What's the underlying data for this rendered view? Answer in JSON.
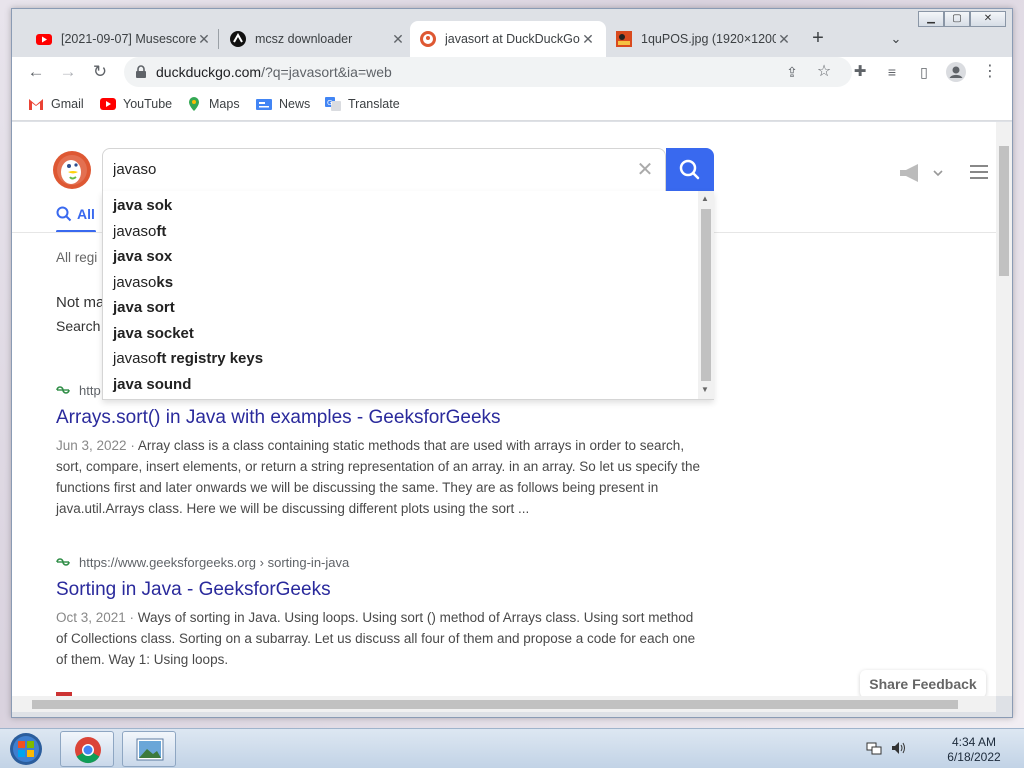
{
  "browser": {
    "tabs": [
      {
        "title": "[2021-09-07] Musescore",
        "icon": "youtube-icon"
      },
      {
        "title": "mcsz downloader",
        "icon": "musescore-icon"
      },
      {
        "title": "javasort at DuckDuckGo",
        "icon": "duckduckgo-icon",
        "active": true
      },
      {
        "title": "1quPOS.jpg (1920×1200",
        "icon": "image-icon"
      }
    ],
    "url_host": "duckduckgo.com",
    "url_rest": "/?q=javasort&ia=web"
  },
  "bookmarks": [
    {
      "label": "Gmail",
      "icon": "gmail-icon"
    },
    {
      "label": "YouTube",
      "icon": "youtube-icon"
    },
    {
      "label": "Maps",
      "icon": "maps-icon"
    },
    {
      "label": "News",
      "icon": "news-icon"
    },
    {
      "label": "Translate",
      "icon": "translate-icon"
    }
  ],
  "search": {
    "query": "javaso",
    "tab_all": "All"
  },
  "suggestions": [
    {
      "typed": "",
      "rest": "java sok"
    },
    {
      "typed": "javaso",
      "rest": "ft"
    },
    {
      "typed": "",
      "rest": "java sox"
    },
    {
      "typed": "javaso",
      "rest": "ks"
    },
    {
      "typed": "",
      "rest": "java sort"
    },
    {
      "typed": "",
      "rest": "java socket"
    },
    {
      "typed": "javaso",
      "rest": "ft registry keys"
    },
    {
      "typed": "",
      "rest": "java sound"
    }
  ],
  "page": {
    "region": "All regi",
    "not_many": "Not ma",
    "search_instead": "Search",
    "feedback": "Share Feedback"
  },
  "results": [
    {
      "url": "http",
      "title": "Arrays.sort() in Java with examples - GeeksforGeeks",
      "date": "Jun 3, 2022",
      "snippet": "Array class is a class containing static methods that are used with arrays in order to search, sort, compare, insert elements, or return a string representation of an array. in an array. So let us specify the functions first and later onwards we will be discussing the same. They are as follows being present in java.util.Arrays class. Here we will be discussing different plots using the sort ..."
    },
    {
      "url": "https://www.geeksforgeeks.org › sorting-in-java",
      "title": "Sorting in Java - GeeksforGeeks",
      "date": "Oct 3, 2021",
      "snippet": "Ways of sorting in Java. Using loops. Using sort () method of Arrays class. Using sort method of Collections class. Sorting on a subarray. Let us discuss all four of them and propose a code for each one of them. Way 1: Using loops."
    }
  ],
  "taskbar": {
    "time": "4:34 AM",
    "date": "6/18/2022"
  },
  "colors": {
    "ddg_blue": "#3969ef",
    "ddg_orange": "#de5833",
    "result_title": "#2a2a9c"
  }
}
